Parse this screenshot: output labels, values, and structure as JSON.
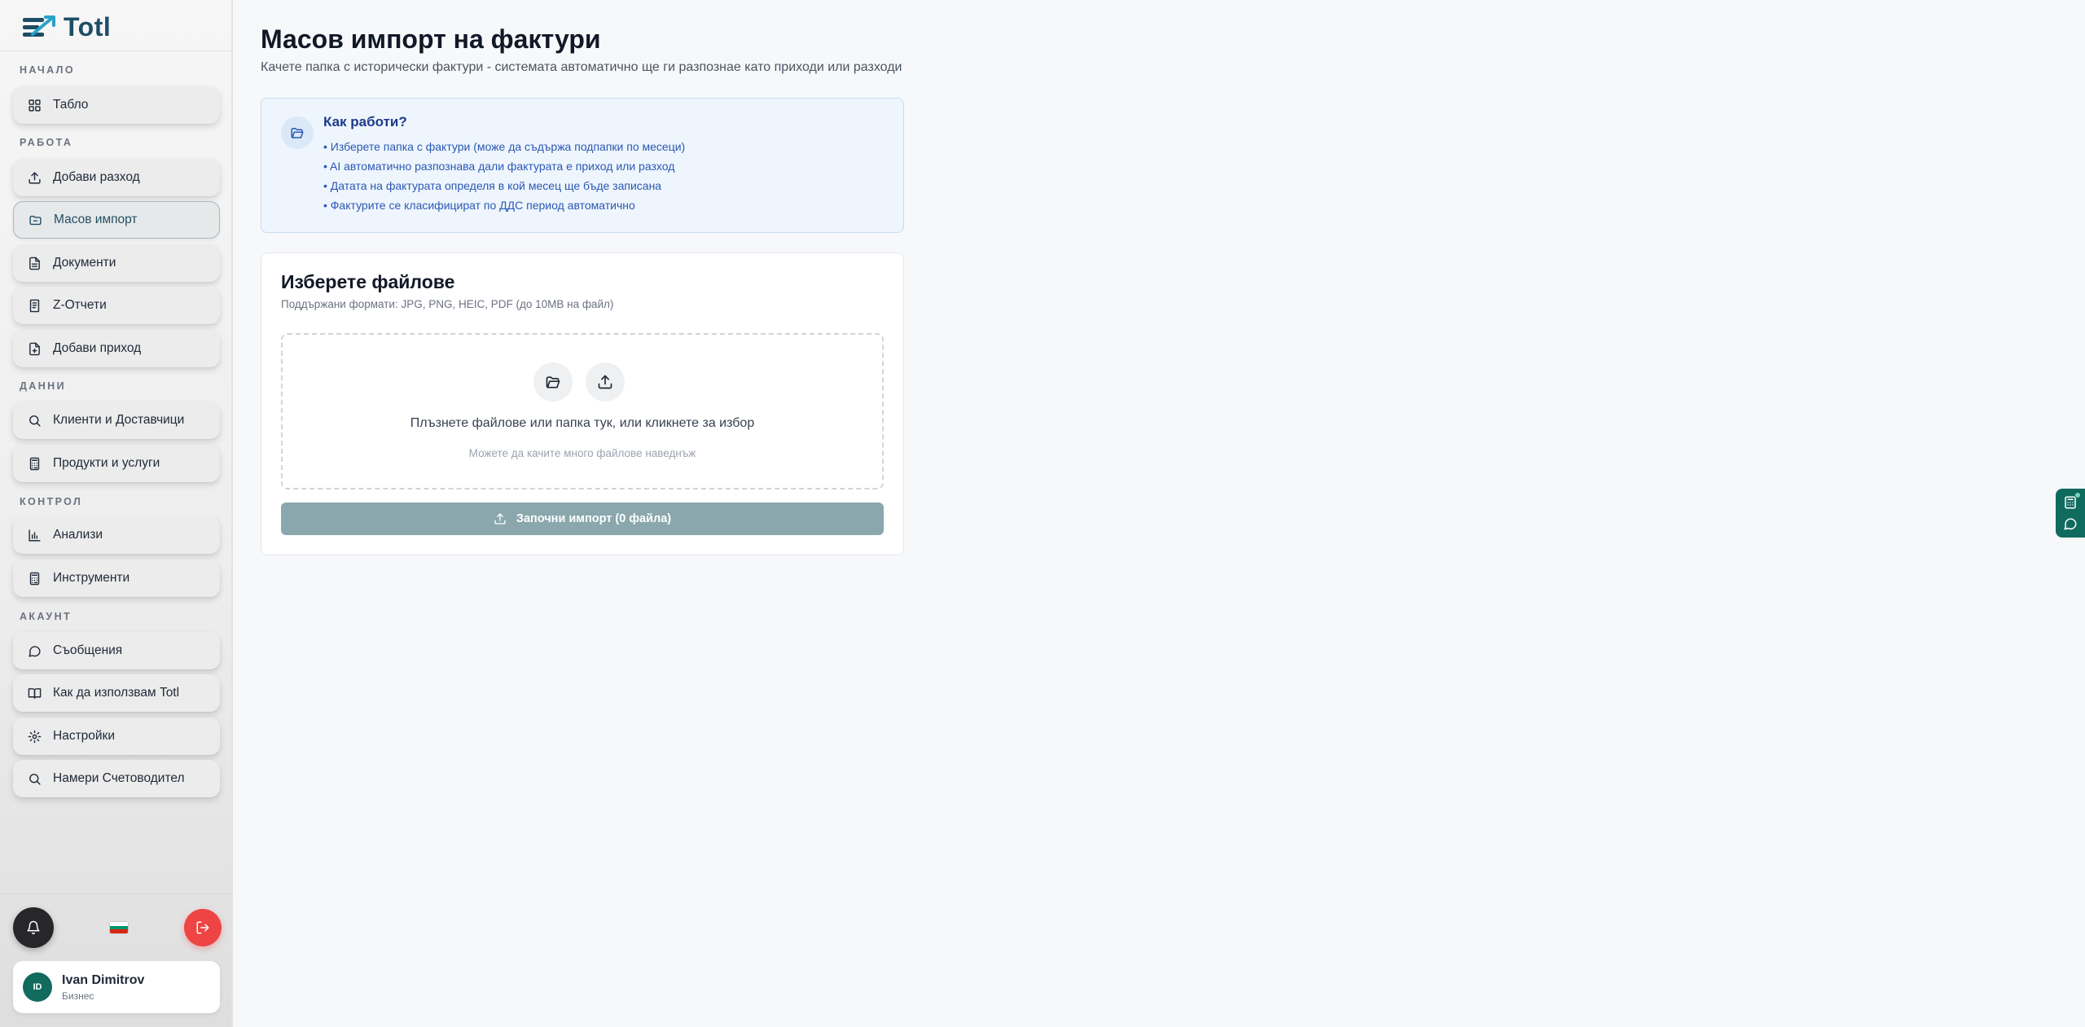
{
  "app": {
    "name": "Totl"
  },
  "sidebar": {
    "sections": [
      {
        "label": "НАЧАЛО",
        "items": [
          {
            "label": "Табло",
            "icon": "dashboard-grid-icon"
          }
        ]
      },
      {
        "label": "РАБОТА",
        "items": [
          {
            "label": "Добави разход",
            "icon": "upload-icon"
          },
          {
            "label": "Масов импорт",
            "icon": "folder-icon",
            "active": true
          },
          {
            "label": "Документи",
            "icon": "document-icon"
          },
          {
            "label": "Z-Отчети",
            "icon": "receipt-icon"
          },
          {
            "label": "Добави приход",
            "icon": "file-plus-icon"
          }
        ]
      },
      {
        "label": "ДАННИ",
        "items": [
          {
            "label": "Клиенти и Доставчици",
            "icon": "search-icon"
          },
          {
            "label": "Продукти и услуги",
            "icon": "calculator-icon"
          }
        ]
      },
      {
        "label": "КОНТРОЛ",
        "items": [
          {
            "label": "Анализи",
            "icon": "bar-chart-icon"
          },
          {
            "label": "Инструменти",
            "icon": "calculator-icon"
          }
        ]
      },
      {
        "label": "АКАУНТ",
        "items": [
          {
            "label": "Съобщения",
            "icon": "message-icon"
          },
          {
            "label": "Как да използвам Totl",
            "icon": "book-icon"
          },
          {
            "label": "Настройки",
            "icon": "gear-icon"
          },
          {
            "label": "Намери Счетоводител",
            "icon": "search-icon"
          }
        ]
      }
    ],
    "user": {
      "initials": "ID",
      "name": "Ivan Dimitrov",
      "plan": "Бизнес"
    },
    "flag_colors": [
      "#ffffff",
      "#00966e",
      "#d62612"
    ]
  },
  "main": {
    "title": "Масов импорт на фактури",
    "subtitle": "Качете папка с исторически фактури - системата автоматично ще ги разпознае като приходи или разходи",
    "info": {
      "title": "Как работи?",
      "items": [
        "• Изберете папка с фактури (може да съдържа подпапки по месеци)",
        "• AI автоматично разпознава дали фактурата е приход или разход",
        "• Датата на фактурата определя в кой месец ще бъде записана",
        "• Фактурите се класифицират по ДДС период автоматично"
      ]
    },
    "upload": {
      "title": "Изберете файлове",
      "formats": "Поддържани формати: JPG, PNG, HEIC, PDF (до 10MB на файл)",
      "drop_text": "Плъзнете файлове или папка тук, или кликнете за избор",
      "drop_hint": "Можете да качите много файлове наведнъж",
      "start_label": "Започни импорт (0 файла)"
    }
  },
  "colors": {
    "brand": "#1d4e66",
    "accent_green": "#0f6b5e",
    "danger": "#ef4444",
    "button_disabled": "#8aa7ad"
  }
}
